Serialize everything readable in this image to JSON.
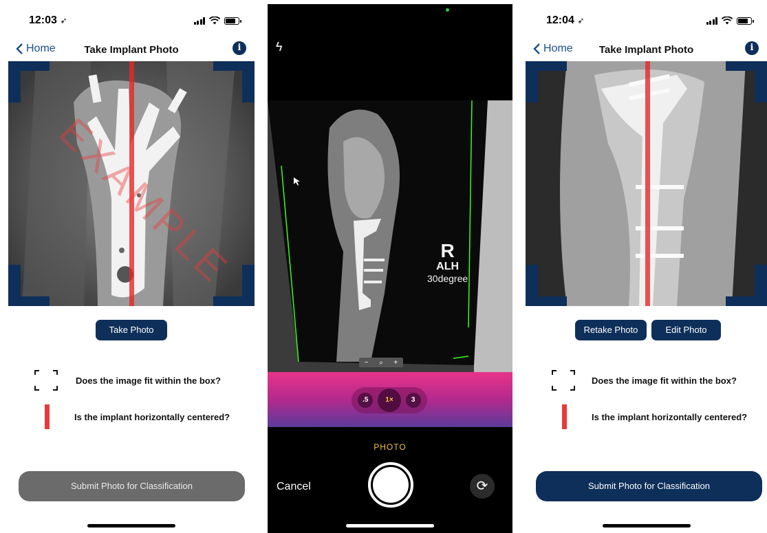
{
  "screen1": {
    "status_time": "12:03",
    "nav": {
      "back_label": "Home",
      "title": "Take Implant Photo"
    },
    "watermark": "EXAMPLE",
    "take_photo_label": "Take Photo",
    "checklist": [
      "Does the image fit within the box?",
      "Is the implant horizontally centered?"
    ],
    "submit_label": "Submit Photo for Classification",
    "submit_state": "disabled"
  },
  "camera": {
    "film_label": [
      "R",
      "ALH",
      "30degree"
    ],
    "zoom_controls": [
      "−",
      "🔍",
      "+"
    ],
    "lenses": [
      ".5",
      "1×",
      "3"
    ],
    "selected_lens": "1×",
    "mode": "PHOTO",
    "cancel_label": "Cancel"
  },
  "screen3": {
    "status_time": "12:04",
    "nav": {
      "back_label": "Home",
      "title": "Take Implant Photo"
    },
    "retake_label": "Retake Photo",
    "edit_label": "Edit Photo",
    "checklist": [
      "Does the image fit within the box?",
      "Is the implant horizontally centered?"
    ],
    "submit_label": "Submit Photo for Classification",
    "submit_state": "enabled"
  },
  "colors": {
    "brand_navy": "#0e2f5a",
    "guide_red": "#e83a3a",
    "camera_accent": "#f5c542"
  },
  "icons": [
    "location-arrow-icon",
    "signal-icon",
    "wifi-icon",
    "battery-icon",
    "chevron-left-icon",
    "info-icon",
    "flash-icon",
    "camera-flip-icon"
  ]
}
